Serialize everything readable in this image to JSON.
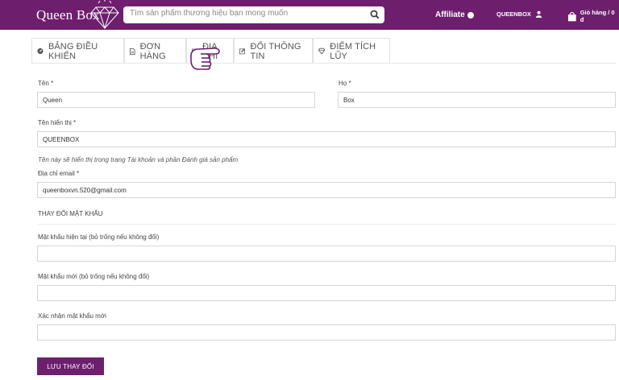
{
  "header": {
    "brand": "Queen Box",
    "search_placeholder": "Tìm sản phẩm thương hiệu bạn mong muốn",
    "affiliate_label": "Affiliate",
    "account_name": "QUEENBOX",
    "cart_label": "Giỏ hàng / 0 đ",
    "accent_color": "#6d1f6e"
  },
  "tabs": [
    {
      "label": "BẢNG ĐIỀU KHIỂN",
      "icon": "dashboard-icon"
    },
    {
      "label": "ĐƠN HÀNG",
      "icon": "document-icon"
    },
    {
      "label": "ĐỊA CHỈ",
      "icon": "address-icon"
    },
    {
      "label": "ĐỔI THÔNG TIN",
      "icon": "edit-icon"
    },
    {
      "label": "ĐIỂM TÍCH LŨY",
      "icon": "diamond-icon"
    }
  ],
  "form": {
    "first_name_label": "Tên *",
    "first_name_value": "Queen",
    "last_name_label": "Họ *",
    "last_name_value": "Box",
    "display_name_label": "Tên hiển thị *",
    "display_name_value": "QUEENBOX",
    "display_name_note": "Tên này sẽ hiển thị trong trang Tài khoản và phần Đánh giá sản phẩm",
    "email_label": "Địa chỉ email *",
    "email_value": "queenboxvn.520@gmail.com",
    "password_section_title": "THAY ĐỔI MẬT KHẨU",
    "current_password_label": "Mật khẩu hiện tại (bỏ trống nếu không đổi)",
    "new_password_label": "Mật khẩu mới (bỏ trống nếu không đổi)",
    "confirm_password_label": "Xác nhận mật khẩu mới",
    "save_button": "LƯU THAY ĐỔI"
  }
}
